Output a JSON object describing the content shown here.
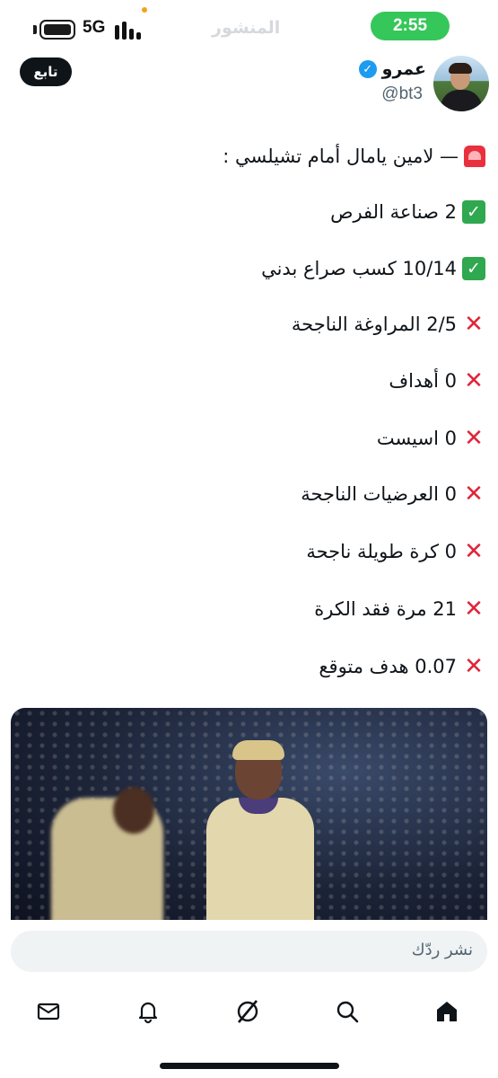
{
  "status_bar": {
    "network": "5G",
    "time": "2:55",
    "ghost_title": "المنشور"
  },
  "header": {
    "follow_label": "تابع",
    "display_name": "عمرو",
    "handle": "@bt3",
    "verified_badge": "✓"
  },
  "tweet": {
    "lines": [
      {
        "icon": "siren-icon",
        "text": "— لامين يامال أمام تشيلسي :"
      },
      {
        "icon": "check-icon",
        "text": "2 صناعة الفرص"
      },
      {
        "icon": "check-icon",
        "text": "10/14 كسب صراع بدني"
      },
      {
        "icon": "cross-icon",
        "text": "2/5 المراوغة الناجحة"
      },
      {
        "icon": "cross-icon",
        "text": "0 أهداف"
      },
      {
        "icon": "cross-icon",
        "text": "0 اسيست"
      },
      {
        "icon": "cross-icon",
        "text": "0 العرضيات الناجحة"
      },
      {
        "icon": "cross-icon",
        "text": "0 كرة طويلة ناجحة"
      },
      {
        "icon": "cross-icon",
        "text": "21 مرة فقد الكرة"
      },
      {
        "icon": "cross-icon",
        "text": "0.07 هدف متوقع"
      }
    ]
  },
  "reply": {
    "placeholder": "نشر ردّك"
  },
  "nav": {
    "items": [
      "mail-icon",
      "bell-icon",
      "grok-icon",
      "search-icon",
      "home-icon"
    ]
  },
  "colors": {
    "time_pill": "#35c759",
    "verified": "#1d9bf0",
    "check": "#2fa84f",
    "cross": "#e0243a"
  }
}
